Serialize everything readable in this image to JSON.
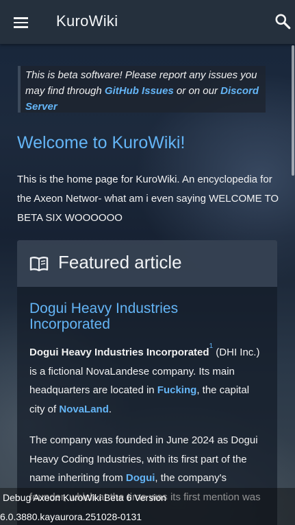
{
  "app_bar": {
    "title": "KuroWiki",
    "menu_icon": "menu-icon",
    "search_icon": "search-icon"
  },
  "notice": {
    "text_before": "This is beta software! Please report any issues you may find through ",
    "github_link": "GitHub Issues",
    "text_middle": " or on our ",
    "discord_link": "Discord Server"
  },
  "page": {
    "title": "Welcome to KuroWiki!",
    "intro": "This is the home page for KuroWiki. An encyclopedia for the Axeon Networ- what am i even saying WELCOME TO BETA SIX WOOOOOO"
  },
  "featured": {
    "icon": "book-open-icon",
    "heading": "Featured article",
    "article_title": "Dogui Heavy Industries Incorporated",
    "p1": {
      "bold_name": "Dogui Heavy Industries Incorporated",
      "footnote": "1",
      "text1": " (DHI Inc.) is a fictional NovaLandese company. Its main headquarters are located in ",
      "link1": "Fucking",
      "text2": ", the capital city of ",
      "link2": "NovaLand",
      "text3": "."
    },
    "p2": {
      "text1": "The company was founded in June 2024 as Dogui Heavy Coding Industries, with its first part of the name inheriting from ",
      "link1": "Dogui",
      "text2": ", the ",
      "hidden_text": "company's founder, which at the time was its first mention was"
    }
  },
  "debug": {
    "line1": "Debug Axeon KuroWiki Beta 6 Version",
    "line2": "6.0.3880.kayaurora.251028-0131"
  },
  "colors": {
    "accent": "#64b5f6",
    "app_bar": "#25303d"
  }
}
